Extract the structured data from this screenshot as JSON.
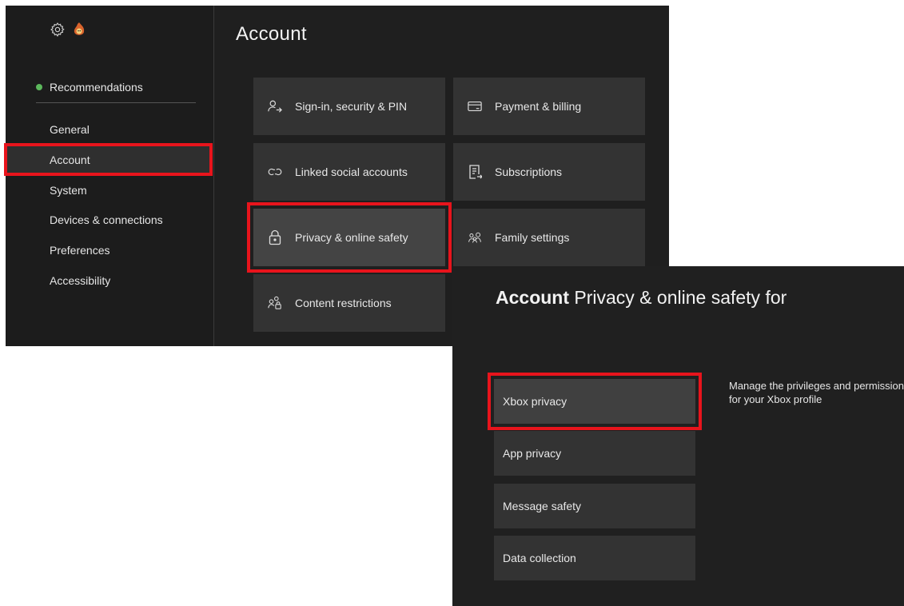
{
  "account_panel": {
    "title": "Account",
    "sidebar": {
      "recommendations": "Recommendations",
      "items": [
        {
          "label": "General"
        },
        {
          "label": "Account",
          "selected": true
        },
        {
          "label": "System"
        },
        {
          "label": "Devices & connections"
        },
        {
          "label": "Preferences"
        },
        {
          "label": "Accessibility"
        }
      ]
    },
    "tiles": [
      {
        "label": "Sign-in, security & PIN",
        "icon": "person-arrow-icon"
      },
      {
        "label": "Payment & billing",
        "icon": "credit-card-icon"
      },
      {
        "label": "Linked social accounts",
        "icon": "link-icon"
      },
      {
        "label": "Subscriptions",
        "icon": "subscriptions-icon"
      },
      {
        "label": "Privacy & online safety",
        "icon": "lock-icon",
        "highlighted": true
      },
      {
        "label": "Family settings",
        "icon": "family-icon"
      },
      {
        "label": "Content restrictions",
        "icon": "content-restrictions-icon"
      }
    ]
  },
  "privacy_panel": {
    "title_bold": "Account",
    "title_rest": "Privacy & online safety for",
    "options": [
      {
        "label": "Xbox privacy",
        "highlighted": true
      },
      {
        "label": "App privacy"
      },
      {
        "label": "Message safety"
      },
      {
        "label": "Data collection"
      }
    ],
    "description": "Manage the privileges and permissions for your Xbox profile"
  },
  "colors": {
    "highlight": "#e8141c",
    "status_dot": "#5cb85c",
    "background": "#1f1f1f",
    "tile": "#333333"
  }
}
